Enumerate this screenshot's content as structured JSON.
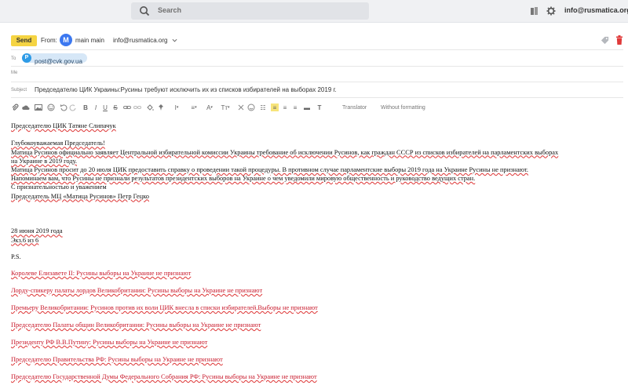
{
  "search": {
    "placeholder": "Search"
  },
  "header": {
    "account": "info@rusmatica.org"
  },
  "compose": {
    "send_label": "Send",
    "from_label": "From:",
    "from_avatar": "M",
    "from_name": "main main",
    "from_email": "info@rusmatica.org",
    "to_label": "To",
    "to_avatar": "P",
    "to_email": "post@cvk.gov.ua",
    "me_label": "Me",
    "subject_label": "Subject",
    "subject": "Председателю ЦИК Украины:Русины требуют исключить их из списков избирателей на выборах 2019 г."
  },
  "toolbar": {
    "translator": "Translator",
    "without_formatting": "Without formatting"
  },
  "body": {
    "greeting_to": "Председателю ЦИК Татяне Слипачук",
    "salutation": "Глубокоуважаемая Председатель!",
    "p1": "Матица Русинов официально заявляет Центральной избирательной комиссии Украины требование об исключении Русинов, как граждан СССР из списков избирателей на парламентских выборах",
    "p1b": "на Украине в 2019 году.",
    "p2": "Матица Русинов просит до 20 июля ЦИК предоставить справку о проведении такой процедуры. В противном случае парламентские выборы 2019 года на Украине Русины не признают.",
    "p3": "Напоминаем вам, что Русины не признали результатов президентских выборов на Украине о чем уведомили мировую общественность и руководство ведущих стран.",
    "closing": "С признательностью и уважением",
    "signature": "Председатель МЦ «Матица Русинов» Петр Гецко",
    "date": "28 июня 2019 года",
    "copy": "Экз.6 из 6",
    "ps": "P.S.",
    "recipients": [
      "Королеве Елизавете II: Русины выборы на Украине не признают",
      "Лорду-спикеру палаты лордов Великобритании: Русины выборы на Украине не признают",
      "Премьеру Великобритании: Русинов против их воли ЦИК внесла в списки избирателей.Выборы не признают",
      "Председателю Палаты общин Великобритании: Русины выборы на Украине не признают",
      "Президенту РФ В.В.Путину: Русины выборы на Украине не признают",
      "Председателю Правительства РФ: Русины выборы на Украине не признают",
      "Председателю Государственной Думы Федерального Собрания РФ: Русины выборы на Украине не признают"
    ]
  }
}
